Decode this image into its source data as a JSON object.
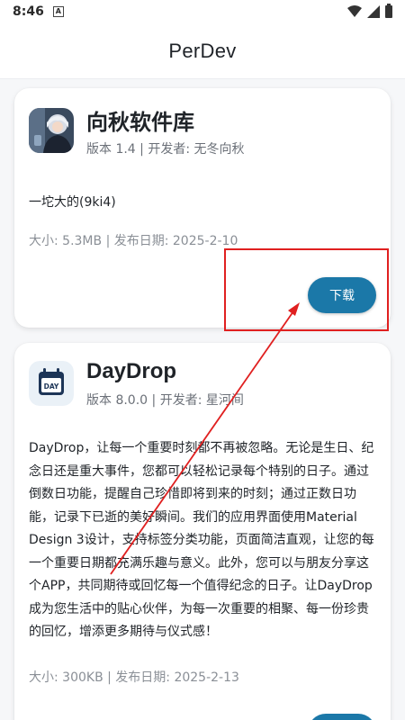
{
  "status_bar": {
    "time": "8:46",
    "notification_icon": "a-square-icon",
    "icons": [
      "wifi-icon",
      "cell-signal-icon",
      "battery-icon"
    ]
  },
  "app_bar": {
    "title": "PerDev"
  },
  "cards": [
    {
      "name": "向秋软件库",
      "meta": "版本 1.4 | 开发者: 无冬向秋",
      "description": "一坨大的(9ki4)",
      "info": "大小: 5.3MB | 发布日期: 2025-2-10",
      "button_label": "下载",
      "icon": "anime-avatar-icon"
    },
    {
      "name": "DayDrop",
      "meta": "版本 8.0.0 | 开发者: 星河间",
      "description": "DayDrop，让每一个重要时刻都不再被忽略。无论是生日、纪念日还是重大事件，您都可以轻松记录每个特别的日子。通过倒数日功能，提醒自己珍惜即将到来的时刻；通过正数日功能，记录下已逝的美好瞬间。我们的应用界面使用Material Design 3设计，支持标签分类功能，页面简洁直观，让您的每一个重要日期都充满乐趣与意义。此外，您可以与朋友分享这个APP，共同期待或回忆每一个值得纪念的日子。让DayDrop成为您生活中的贴心伙伴，为每一次重要的相聚、每一份珍贵的回忆，增添更多期待与仪式感！",
      "info": "大小: 300KB | 发布日期: 2025-2-13",
      "icon_text": "DAY",
      "icon": "calendar-day-icon"
    }
  ],
  "colors": {
    "accent": "#1b78a8",
    "annotation": "#e02020"
  }
}
